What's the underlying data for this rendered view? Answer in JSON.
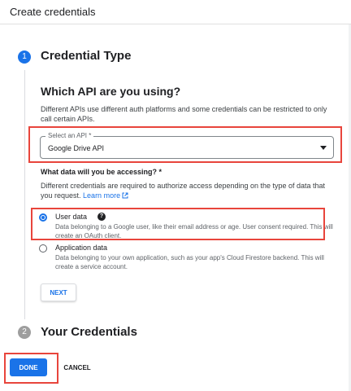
{
  "header": {
    "title": "Create credentials"
  },
  "step1": {
    "number": "1",
    "title": "Credential Type",
    "section_title": "Which API are you using?",
    "description": "Different APIs use different auth platforms and some credentials can be restricted to only call certain APIs.",
    "select": {
      "label": "Select an API *",
      "value": "Google Drive API"
    },
    "access_question": "What data will you be accessing? *",
    "access_description": "Different credentials are required to authorize access depending on the type of data that you request.",
    "learn_more": "Learn more",
    "options": [
      {
        "label": "User data",
        "selected": true,
        "description": "Data belonging to a Google user, like their email address or age. User consent required. This will create an OAuth client."
      },
      {
        "label": "Application data",
        "selected": false,
        "description": "Data belonging to your own application, such as your app's Cloud Firestore backend. This will create a service account."
      }
    ],
    "next_label": "NEXT"
  },
  "step2": {
    "number": "2",
    "title": "Your Credentials"
  },
  "footer": {
    "done_label": "DONE",
    "cancel_label": "CANCEL"
  },
  "colors": {
    "accent": "#1a73e8",
    "highlight": "#e8453c",
    "inactive_step": "#9e9e9e"
  },
  "icons": {
    "help": "help-circle-icon",
    "external_link": "open-in-new-icon",
    "dropdown": "caret-down-icon"
  }
}
